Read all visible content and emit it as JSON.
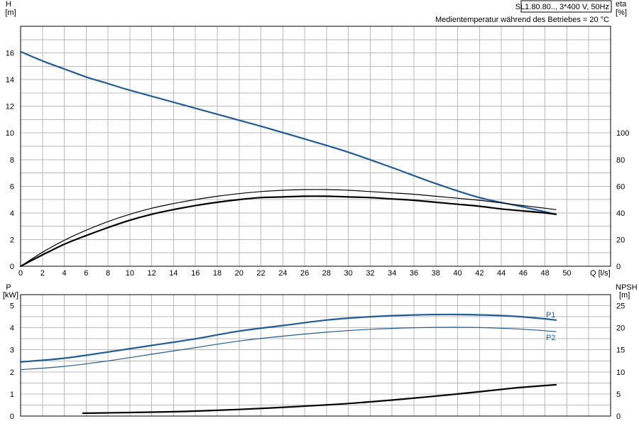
{
  "header": {
    "model": "SL1.80.80.., 3*400 V, 50Hz",
    "conditions": "Medientemperatur während des Betriebes = 20 °C"
  },
  "chart_data": [
    {
      "type": "line",
      "panel": "top",
      "x_axis": {
        "label": "Q [l/s]",
        "range": [
          0,
          54
        ],
        "ticks": [
          0,
          2,
          4,
          6,
          8,
          10,
          12,
          14,
          16,
          18,
          20,
          22,
          24,
          26,
          28,
          30,
          32,
          34,
          36,
          38,
          40,
          42,
          44,
          46,
          48,
          50
        ]
      },
      "y_left": {
        "label": [
          "H",
          "[m]"
        ],
        "range": [
          0,
          18
        ],
        "ticks": [
          0,
          2,
          4,
          6,
          8,
          10,
          12,
          14,
          16
        ]
      },
      "y_right": {
        "label": [
          "eta",
          "[%]"
        ],
        "range": [
          0,
          180
        ],
        "ticks": [
          0,
          20,
          40,
          60,
          80,
          100
        ]
      },
      "grid": true,
      "series": [
        {
          "axis": "left",
          "color": "#1f5c99",
          "width": 2.2,
          "points": [
            [
              0,
              16.1
            ],
            [
              2,
              15.4
            ],
            [
              4,
              14.8
            ],
            [
              6,
              14.2
            ],
            [
              8,
              13.7
            ],
            [
              10,
              13.2
            ],
            [
              14,
              12.3
            ],
            [
              18,
              11.4
            ],
            [
              22,
              10.5
            ],
            [
              26,
              9.55
            ],
            [
              30,
              8.55
            ],
            [
              34,
              7.4
            ],
            [
              38,
              6.2
            ],
            [
              42,
              5.15
            ],
            [
              46,
              4.45
            ],
            [
              49,
              3.9
            ]
          ]
        },
        {
          "axis": "right",
          "color": "#000000",
          "width": 1.2,
          "points": [
            [
              0,
              0
            ],
            [
              2,
              10.5
            ],
            [
              4,
              19.5
            ],
            [
              6,
              27
            ],
            [
              8,
              33.5
            ],
            [
              10,
              39
            ],
            [
              12,
              43.5
            ],
            [
              14,
              47
            ],
            [
              16,
              50
            ],
            [
              18,
              52.5
            ],
            [
              20,
              54.5
            ],
            [
              22,
              56
            ],
            [
              24,
              57
            ],
            [
              26,
              57.5
            ],
            [
              28,
              57.5
            ],
            [
              30,
              57
            ],
            [
              32,
              56
            ],
            [
              34,
              55
            ],
            [
              36,
              54
            ],
            [
              38,
              52.5
            ],
            [
              40,
              51
            ],
            [
              42,
              49.5
            ],
            [
              44,
              47.5
            ],
            [
              46,
              45.5
            ],
            [
              48,
              43.5
            ],
            [
              49,
              42.5
            ]
          ]
        },
        {
          "axis": "right",
          "color": "#000000",
          "width": 2.2,
          "points": [
            [
              0,
              0
            ],
            [
              2,
              8.5
            ],
            [
              4,
              16.5
            ],
            [
              6,
              23
            ],
            [
              8,
              29
            ],
            [
              10,
              34.5
            ],
            [
              12,
              39
            ],
            [
              14,
              42.5
            ],
            [
              16,
              45.5
            ],
            [
              18,
              48
            ],
            [
              20,
              50
            ],
            [
              22,
              51.5
            ],
            [
              24,
              52
            ],
            [
              26,
              52.5
            ],
            [
              28,
              52.5
            ],
            [
              30,
              52
            ],
            [
              32,
              51.5
            ],
            [
              34,
              50.5
            ],
            [
              36,
              49.5
            ],
            [
              38,
              48
            ],
            [
              40,
              46.5
            ],
            [
              42,
              45
            ],
            [
              44,
              43
            ],
            [
              46,
              41.5
            ],
            [
              48,
              40
            ],
            [
              49,
              39
            ]
          ]
        }
      ]
    },
    {
      "type": "line",
      "panel": "bottom",
      "x_axis": {
        "range": [
          0,
          54
        ]
      },
      "y_left": {
        "label": [
          "P",
          "[kW]"
        ],
        "range": [
          0,
          5.5
        ],
        "ticks": [
          0,
          1,
          2,
          3,
          4,
          5
        ]
      },
      "y_right": {
        "label": [
          "NPSH",
          "[m]"
        ],
        "range": [
          0,
          27.5
        ],
        "ticks": [
          0,
          5,
          10,
          15,
          20,
          25
        ]
      },
      "grid": true,
      "series": [
        {
          "name": "P1",
          "axis": "left",
          "color": "#1f5c99",
          "width": 2.2,
          "points": [
            [
              0,
              2.45
            ],
            [
              4,
              2.62
            ],
            [
              8,
              2.9
            ],
            [
              12,
              3.2
            ],
            [
              16,
              3.5
            ],
            [
              20,
              3.85
            ],
            [
              24,
              4.1
            ],
            [
              28,
              4.35
            ],
            [
              32,
              4.5
            ],
            [
              36,
              4.58
            ],
            [
              40,
              4.6
            ],
            [
              44,
              4.55
            ],
            [
              47,
              4.45
            ],
            [
              49,
              4.35
            ]
          ]
        },
        {
          "name": "P2",
          "axis": "left",
          "color": "#1f5c99",
          "width": 1.2,
          "points": [
            [
              0,
              2.1
            ],
            [
              4,
              2.25
            ],
            [
              8,
              2.5
            ],
            [
              12,
              2.8
            ],
            [
              16,
              3.1
            ],
            [
              20,
              3.4
            ],
            [
              24,
              3.62
            ],
            [
              28,
              3.8
            ],
            [
              32,
              3.93
            ],
            [
              36,
              4.0
            ],
            [
              40,
              4.02
            ],
            [
              44,
              3.98
            ],
            [
              47,
              3.9
            ],
            [
              49,
              3.82
            ]
          ]
        },
        {
          "axis": "right",
          "color": "#000000",
          "width": 2.2,
          "points": [
            [
              5.7,
              0.65
            ],
            [
              10,
              0.8
            ],
            [
              15,
              1.05
            ],
            [
              20,
              1.5
            ],
            [
              25,
              2.1
            ],
            [
              30,
              2.85
            ],
            [
              35,
              3.85
            ],
            [
              40,
              5.0
            ],
            [
              45,
              6.3
            ],
            [
              49,
              7.1
            ]
          ]
        }
      ]
    }
  ]
}
